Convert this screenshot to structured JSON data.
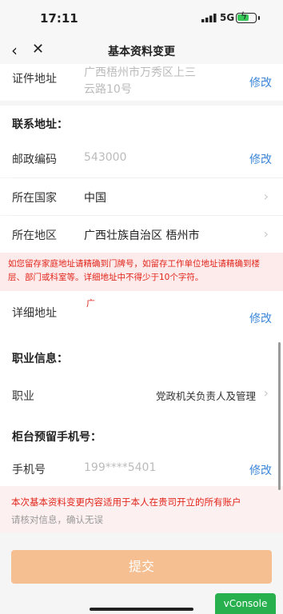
{
  "status_bar": {
    "time": "17:11",
    "network": "5G"
  },
  "nav": {
    "title": "基本资料变更"
  },
  "id_address": {
    "label": "证件地址",
    "value_line1": "广西梧州市万秀区上三",
    "value_line2": "云路10号",
    "action": "修改"
  },
  "contact": {
    "section_title": "联系地址：",
    "postcode": {
      "label": "邮政编码",
      "value": "543000",
      "action": "修改"
    },
    "country": {
      "label": "所在国家",
      "value": "中国"
    },
    "region": {
      "label": "所在地区",
      "value": "广西壮族自治区 梧州市"
    },
    "warning": "如您留存家庭地址请精确到门牌号，如留存工作单位地址请精确到楼层、部门或科室等。详细地址中不得少于10个字符。",
    "detail": {
      "label": "详细地址",
      "value": "广",
      "action": "修改"
    }
  },
  "job": {
    "section_title": "职业信息：",
    "label": "职业",
    "value": "党政机关负责人及管理"
  },
  "phone": {
    "section_title": "柜台预留手机号：",
    "label": "手机号",
    "value": "199****5401",
    "action": "修改"
  },
  "notice": {
    "line1": "本次基本资料变更内容适用于本人在贵司开立的所有账户",
    "line2": "请核对信息，确认无误"
  },
  "submit_label": "提交",
  "vconsole_label": "vConsole",
  "colors": {
    "link": "#3b86d8",
    "warning": "#e1251b",
    "submit": "#f5bf91",
    "vconsole": "#27b04d"
  }
}
